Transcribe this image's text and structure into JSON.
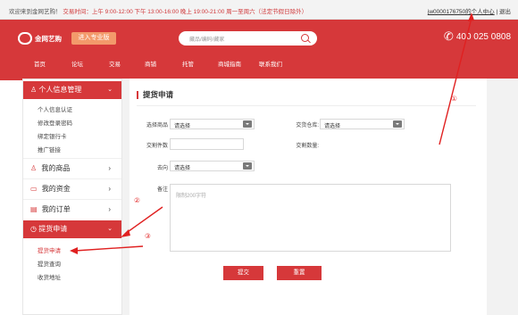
{
  "topbar": {
    "welcome": "欢迎来到金网艺购！",
    "hours_prefix": "交易时间：上午 9:00-12:00 下午 13:00-16:00 晚上 19:00-21:00 周一至周六（法定节假日除外）",
    "account": "jw0000176750的个人中心",
    "divider": "|",
    "logout": "退出"
  },
  "header": {
    "logo_text": "金网艺购",
    "pro_button": "进入专业版",
    "search_placeholder": "藏品/编码/藏家",
    "phone": "400 025 0808",
    "nav": [
      "首页",
      "论坛",
      "交易",
      "商铺",
      "托管",
      "商城指南",
      "联系我们"
    ]
  },
  "sidebar": {
    "personal": {
      "label": "个人信息管理",
      "items": [
        "个人信息认证",
        "修改登录密码",
        "绑定银行卡",
        "推广链接"
      ]
    },
    "my_goods": "我的商品",
    "my_funds": "我的资金",
    "my_orders": "我的订单",
    "pickup": {
      "label": "提货申请",
      "items": [
        "提货申请",
        "提货查询",
        "收货地址"
      ]
    }
  },
  "main": {
    "title": "提货申请",
    "fields": {
      "goods_label": "选择商品",
      "goods_value": "请选择",
      "warehouse_label": "交货仓库:",
      "warehouse_value": "请选择",
      "qty_label": "交割件数",
      "delivery_qty_label": "交割数量:",
      "direction_label": "去向",
      "direction_value": "请选择",
      "remark_label": "备注",
      "remark_placeholder": "限制200字符"
    },
    "submit": "提交",
    "reset": "重置"
  },
  "annotations": [
    "①",
    "②",
    "③"
  ]
}
